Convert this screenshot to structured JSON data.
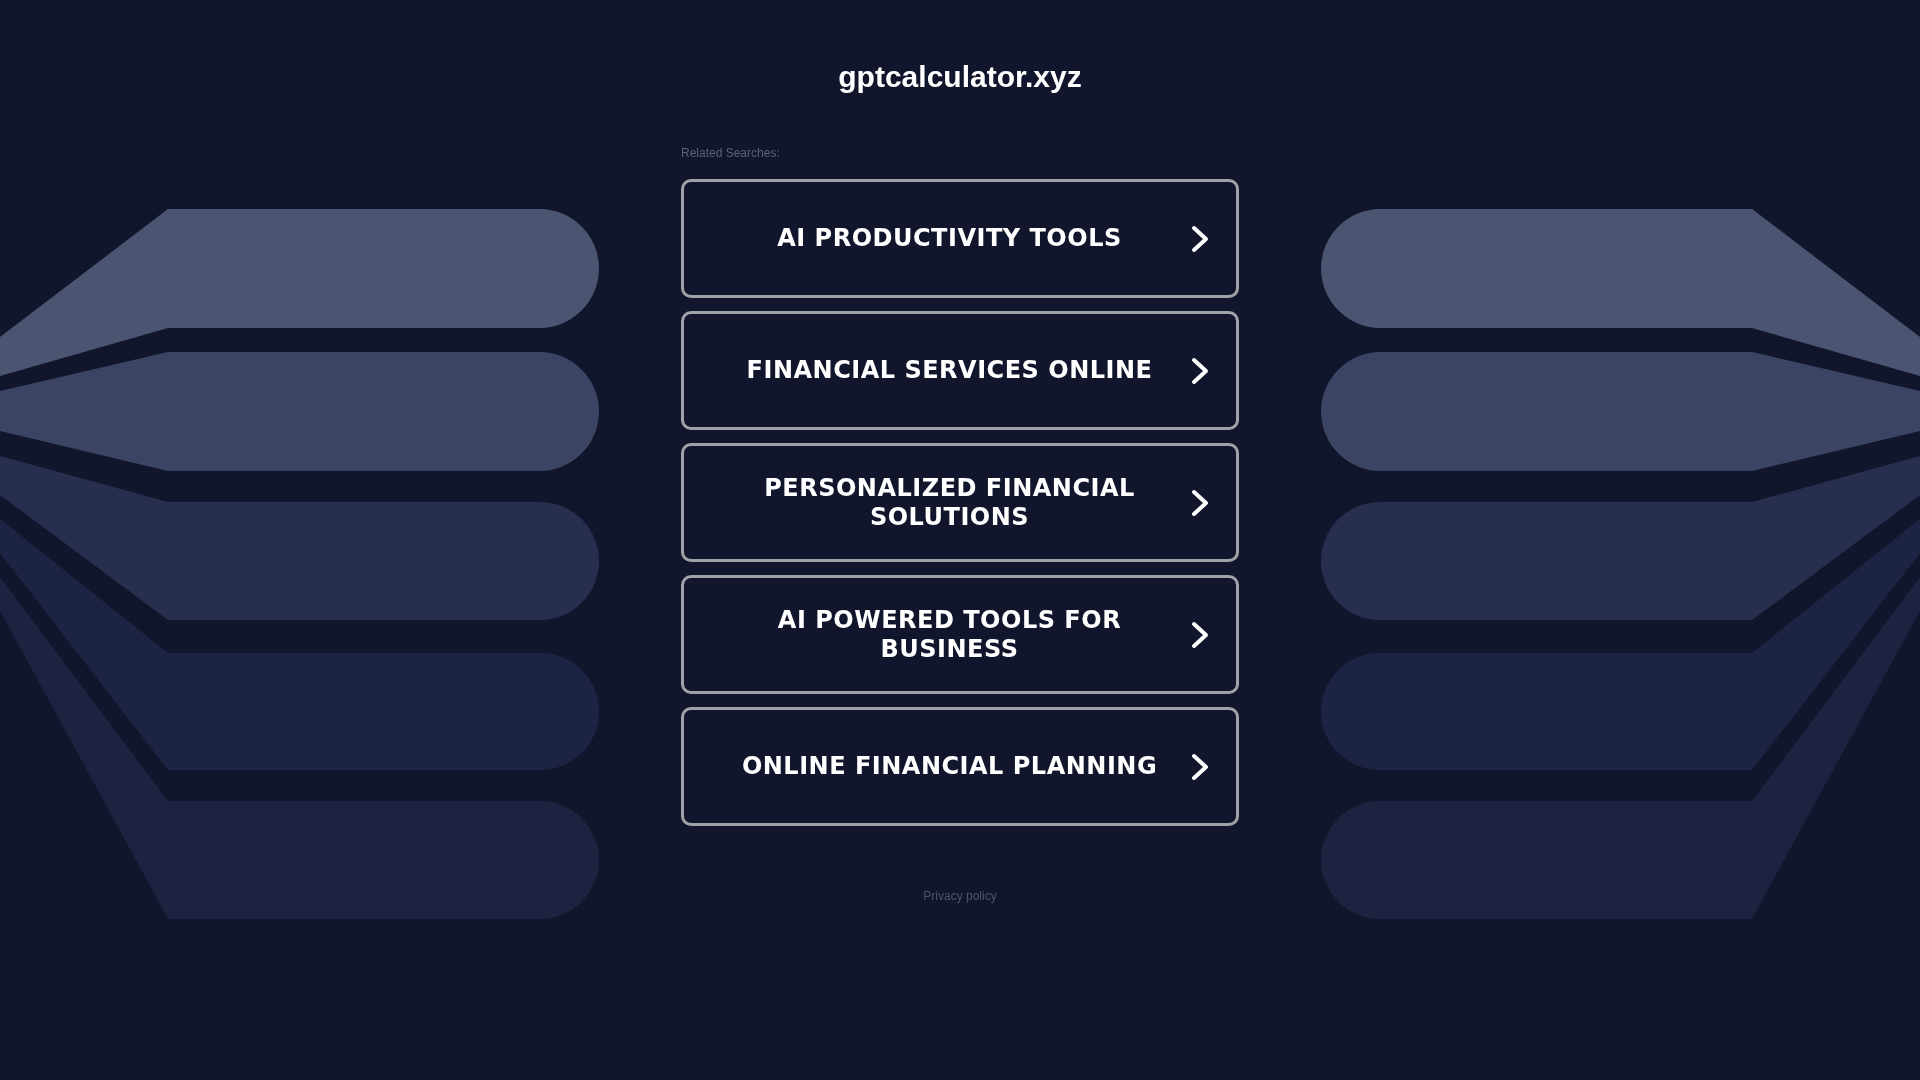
{
  "site_title": "gptcalculator.xyz",
  "related_searches": {
    "heading": "Related Searches:",
    "links": [
      "AI PRODUCTIVITY TOOLS",
      "FINANCIAL SERVICES ONLINE",
      "PERSONALIZED FINANCIAL SOLUTIONS",
      "AI POWERED TOOLS FOR BUSINESS",
      "ONLINE FINANCIAL PLANNING"
    ]
  },
  "footer": {
    "privacy_link": "Privacy policy"
  }
}
